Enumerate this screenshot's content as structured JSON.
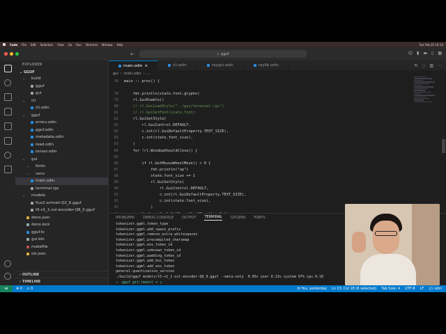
{
  "menubar": {
    "app": "Code",
    "items": [
      "File",
      "Edit",
      "Selection",
      "View",
      "Go",
      "Run",
      "Terminal",
      "Window",
      "Help"
    ],
    "clock": "Tue Feb 25 16:10"
  },
  "titlebar": {
    "search": "gguf"
  },
  "explorer": {
    "title": "EXPLORER",
    "root": "GGUF",
    "items": [
      {
        "label": "build",
        "indent": 1,
        "folder": true,
        "color": "#999"
      },
      {
        "label": "gguf",
        "indent": 2,
        "folder": false,
        "color": "#9aa"
      },
      {
        "label": "gui",
        "indent": 2,
        "folder": false,
        "color": "#9aa"
      },
      {
        "label": "cli",
        "indent": 1,
        "folder": true,
        "color": "#999"
      },
      {
        "label": "cli.odin",
        "indent": 2,
        "folder": false,
        "color": "#2b8de0"
      },
      {
        "label": "gguf",
        "indent": 1,
        "folder": true,
        "color": "#999"
      },
      {
        "label": "errors.odin",
        "indent": 2,
        "folder": false,
        "color": "#2b8de0"
      },
      {
        "label": "gguf.odin",
        "indent": 2,
        "folder": false,
        "color": "#2b8de0"
      },
      {
        "label": "metadata.odin",
        "indent": 2,
        "folder": false,
        "color": "#2b8de0"
      },
      {
        "label": "read.odin",
        "indent": 2,
        "folder": false,
        "color": "#2b8de0"
      },
      {
        "label": "tensor.odin",
        "indent": 2,
        "folder": false,
        "color": "#2b8de0"
      },
      {
        "label": "gui",
        "indent": 1,
        "folder": true,
        "color": "#999"
      },
      {
        "label": "fonts",
        "indent": 2,
        "folder": true,
        "color": "#999"
      },
      {
        "label": "venv",
        "indent": 2,
        "folder": true,
        "color": "#999"
      },
      {
        "label": "main.odin",
        "indent": 2,
        "folder": false,
        "color": "#2b8de0",
        "selected": true
      },
      {
        "label": "terminal.rgs",
        "indent": 2,
        "folder": false,
        "color": "#9aa"
      },
      {
        "label": "models",
        "indent": 1,
        "folder": true,
        "color": "#999"
      },
      {
        "label": "flux1-schnell-Q2_K.gguf",
        "indent": 2,
        "folder": false,
        "color": "#9aa"
      },
      {
        "label": "t5-v1_1-xxl-encoder-Q8_0.gguf",
        "indent": 2,
        "folder": false,
        "color": "#9aa"
      },
      {
        "label": "deno.json",
        "indent": 1,
        "folder": false,
        "color": "#e0b040"
      },
      {
        "label": "deno.lock",
        "indent": 1,
        "folder": false,
        "color": "#9aa"
      },
      {
        "label": "gguf.ts",
        "indent": 1,
        "folder": false,
        "color": "#2b8de0"
      },
      {
        "label": "gui.bin",
        "indent": 1,
        "folder": false,
        "color": "#9aa"
      },
      {
        "label": "makefile",
        "indent": 1,
        "folder": false,
        "color": "#c05050"
      },
      {
        "label": "ols.json",
        "indent": 1,
        "folder": false,
        "color": "#e0b040"
      }
    ],
    "outline": "OUTLINE",
    "timeline": "TIMELINE"
  },
  "tabs": [
    {
      "label": "main.odin",
      "active": true
    },
    {
      "label": "cli.odin",
      "active": false
    },
    {
      "label": "raygui.odin",
      "active": false
    },
    {
      "label": "raylib.odin",
      "active": false
    }
  ],
  "breadcrumb": [
    "gui",
    "main.odin",
    "..."
  ],
  "editor": {
    "lines": [
      {
        "n": "38",
        "text": "main :: proc() {",
        "type": "code"
      },
      {
        "n": "",
        "text": "",
        "type": "code"
      },
      {
        "n": "78",
        "text": "    fmt.println(state.font.glyphs)",
        "type": "code"
      },
      {
        "n": "79",
        "text": "    rl.GuiEnable()",
        "type": "code"
      },
      {
        "n": "80",
        "text": "    // rl.GuiLoadStyle(\"../gui/terminal.rgs\")",
        "type": "comment"
      },
      {
        "n": "81",
        "text": "    // rl.GuiSetFont(state.font)",
        "type": "comment"
      },
      {
        "n": "81",
        "text": "    rl.GuiSetStyle(",
        "type": "code"
      },
      {
        "n": "82",
        "text": "        rl.GuiControl.DEFAULT,",
        "type": "code"
      },
      {
        "n": "82",
        "text": "        c.int(rl.GuiDefaultProperty.TEXT_SIZE),",
        "type": "code"
      },
      {
        "n": "83",
        "text": "        c.int(state.font_size),",
        "type": "code"
      },
      {
        "n": "83",
        "text": "    )",
        "type": "code"
      },
      {
        "n": "84",
        "text": "    for !rl.WindowShouldClose() {",
        "type": "kw"
      },
      {
        "n": "85",
        "text": "",
        "type": "code"
      },
      {
        "n": "86",
        "text": "        if rl.GetMouseWheelMove() > 0 {",
        "type": "kw"
      },
      {
        "n": "87",
        "text": "            fmt.println(\"up\")",
        "type": "code"
      },
      {
        "n": "88",
        "text": "            state.font_size += 1",
        "type": "code"
      },
      {
        "n": "89",
        "text": "            rl.GuiSetStyle(",
        "type": "code"
      },
      {
        "n": "90",
        "text": "                rl.GuiControl.DEFAULT,",
        "type": "code"
      },
      {
        "n": "91",
        "text": "                c.int(rl.GuiDefaultProperty.TEXT_SIZE),",
        "type": "code"
      },
      {
        "n": "92",
        "text": "                c.int(state.font_size),",
        "type": "code"
      },
      {
        "n": "93",
        "text": "            )",
        "type": "code"
      },
      {
        "n": "94",
        "text": "        } else if rl.GetMouseWheelMove() < 0 {",
        "type": "kw"
      }
    ]
  },
  "panel": {
    "tabs": [
      {
        "label": "PROBLEMS",
        "active": false
      },
      {
        "label": "DEBUG CONSOLE",
        "active": false
      },
      {
        "label": "OUTPUT",
        "active": false
      },
      {
        "label": "TERMINAL",
        "active": true
      },
      {
        "label": "GITLENS",
        "active": false
      },
      {
        "label": "PORTS",
        "active": false
      }
    ],
    "terminal_lines": [
      "tokenizer.ggml.token_type",
      "tokenizer.ggml.add_space_prefix",
      "tokenizer.ggml.remove_extra_whitespaces",
      "tokenizer.ggml.precompiled_charsmap",
      "tokenizer.ggml.eos_token_id",
      "tokenizer.ggml.unknown_token_id",
      "tokenizer.ggml.padding_token_id",
      "tokenizer.ggml.add_bos_token",
      "tokenizer.ggml.add_eos_token",
      "general.quantization_version",
      "./build/gguf models/t5-v1_1-xxl-encoder-Q8_0.gguf --meta-only  0.05s user 0.13s system 97% cpu 0.18"
    ],
    "prompt": "→  gguf git:(main) ✗ ▯"
  },
  "status": {
    "left": [
      "⊗ 0",
      "⚠ 0"
    ],
    "right": [
      "◔ You, yesterday",
      "Ln 13, Col 18 (6 selected)",
      "Tab Size: 4",
      "UTF-8",
      "LF",
      "{} odin"
    ]
  }
}
